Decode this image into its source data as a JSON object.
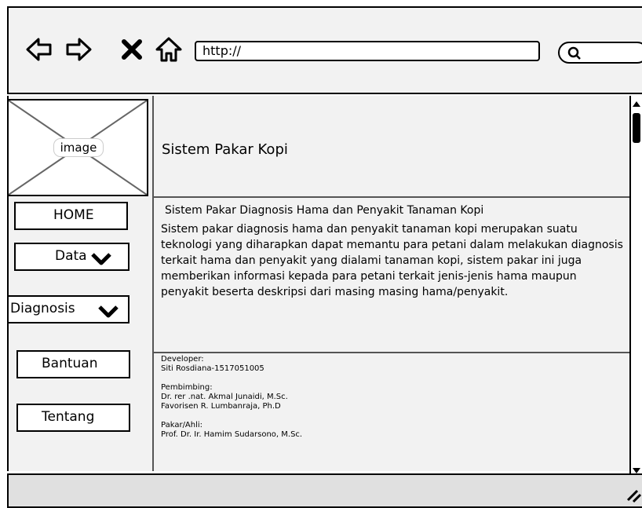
{
  "browser": {
    "url": "http://",
    "back_icon": "arrow-left-icon",
    "forward_icon": "arrow-right-icon",
    "close_icon": "x-icon",
    "home_icon": "home-icon",
    "search_icon": "magnifier-icon"
  },
  "sidebar": {
    "image_label": "image",
    "items": [
      {
        "label": "HOME"
      },
      {
        "label": "Data"
      },
      {
        "label": "Diagnosis"
      },
      {
        "label": "Bantuan"
      },
      {
        "label": "Tentang"
      }
    ]
  },
  "main": {
    "title": "Sistem Pakar Kopi",
    "content_title": "Sistem Pakar Diagnosis Hama dan Penyakit Tanaman Kopi",
    "content_body": "Sistem pakar diagnosis hama dan penyakit tanaman kopi merupakan suatu teknologi yang diharapkan dapat memantu para petani dalam melakukan diagnosis terkait hama dan penyakit yang dialami tanaman kopi, sistem pakar ini juga memberikan informasi kepada para petani terkait jenis-jenis hama maupun penyakit beserta deskripsi dari masing masing hama/penyakit.",
    "developer_label": "Developer:",
    "developer_name": "Siti Rosdiana-1517051005",
    "advisor_label": "Pembimbing:",
    "advisor_1": "Dr. rer .nat. Akmal Junaidi, M.Sc.",
    "advisor_2": "Favorisen R. Lumbanraja, Ph.D",
    "expert_label": "Pakar/Ahli:",
    "expert_name": "Prof. Dr. Ir. Hamim Sudarsono, M.Sc."
  },
  "colors": {
    "frame": "#000000",
    "panel": "#f2f2f2",
    "footer": "#e0e0e0"
  }
}
